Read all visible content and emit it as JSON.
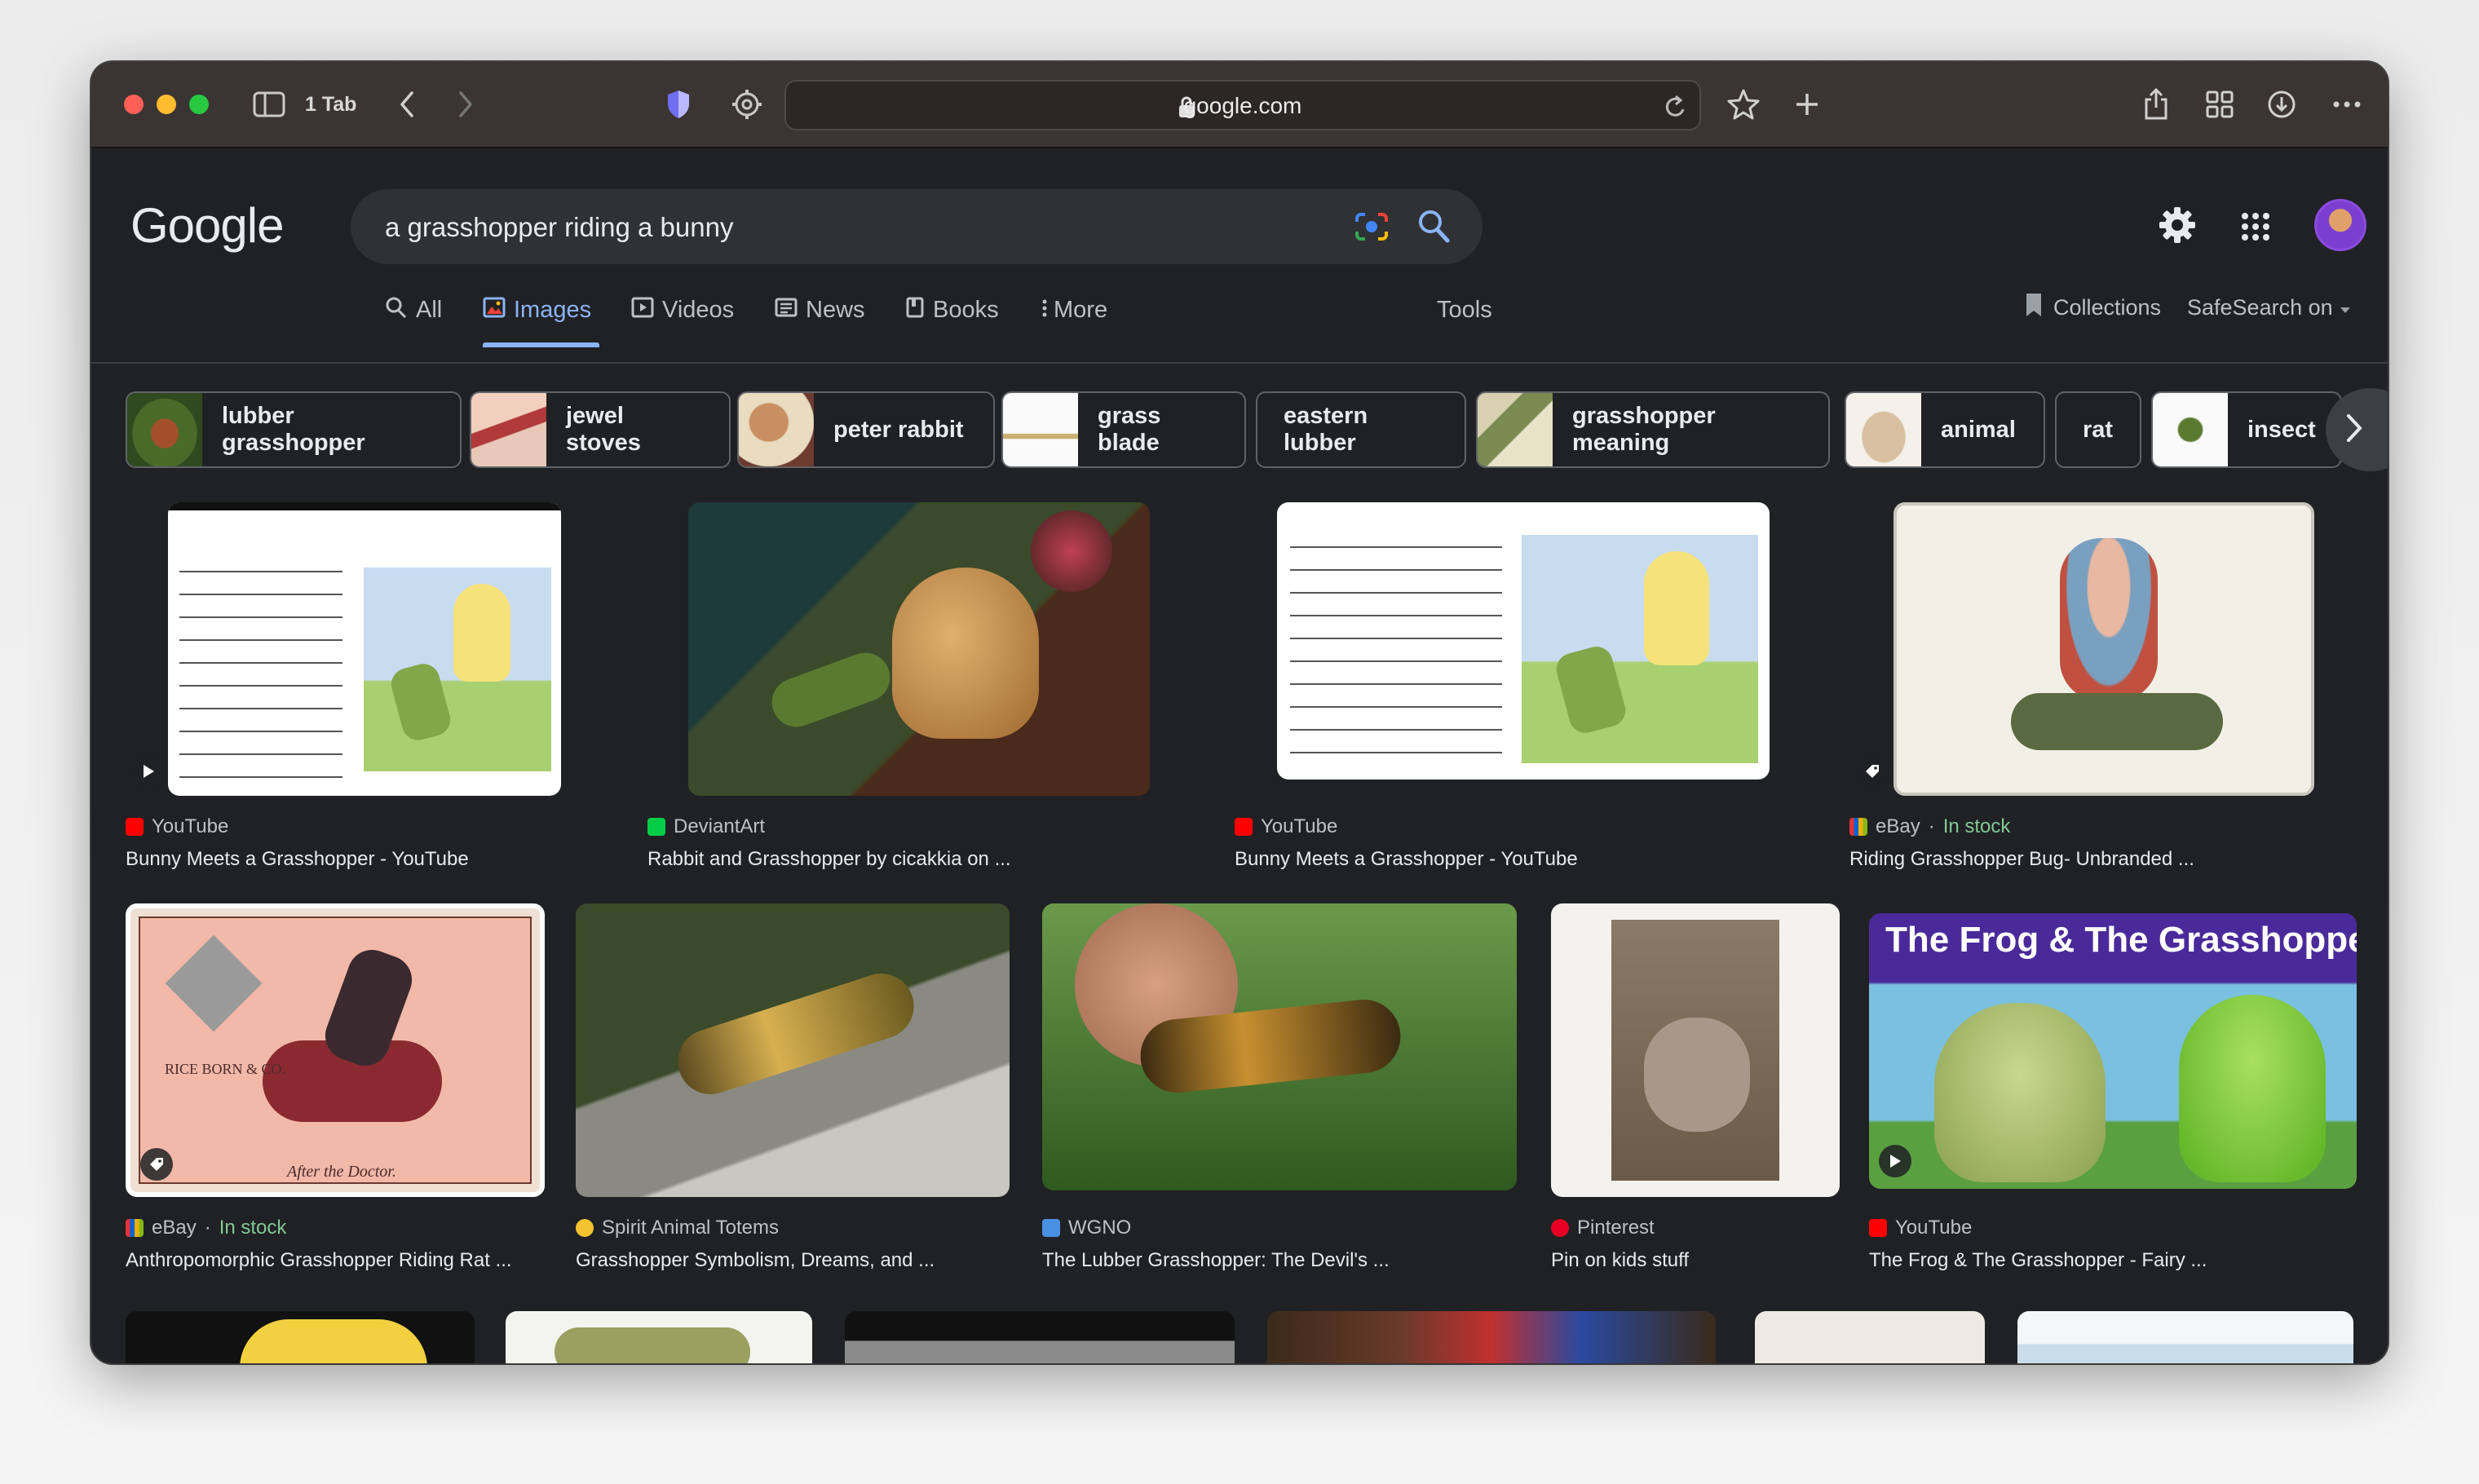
{
  "browser": {
    "tab_count": "1 Tab",
    "url": "google.com"
  },
  "google": {
    "logo": "Google",
    "query": "a grasshopper riding a bunny"
  },
  "tabs": [
    {
      "label": "All"
    },
    {
      "label": "Images",
      "active": true
    },
    {
      "label": "Videos"
    },
    {
      "label": "News"
    },
    {
      "label": "Books"
    },
    {
      "label": "More"
    },
    {
      "label": "Tools"
    }
  ],
  "collections_label": "Collections",
  "safesearch_label": "SafeSearch on",
  "chips": [
    {
      "label": "lubber grasshopper"
    },
    {
      "label": "jewel stoves"
    },
    {
      "label": "peter rabbit"
    },
    {
      "label": "grass blade"
    },
    {
      "label": "eastern lubber"
    },
    {
      "label": "grasshopper meaning"
    },
    {
      "label": "animal"
    },
    {
      "label": "rat"
    },
    {
      "label": "insect"
    }
  ],
  "results": [
    {
      "source": "YouTube",
      "title": "Bunny Meets a Grasshopper - YouTube"
    },
    {
      "source": "DeviantArt",
      "title": "Rabbit and Grasshopper by cicakkia on ..."
    },
    {
      "source": "YouTube",
      "title": "Bunny Meets a Grasshopper - YouTube"
    },
    {
      "source": "eBay",
      "stock": "In stock",
      "title": "Riding Grasshopper Bug- Unbranded ..."
    },
    {
      "source": "eBay",
      "stock": "In stock",
      "title": "Anthropomorphic Grasshopper Riding Rat ..."
    },
    {
      "source": "Spirit Animal Totems",
      "title": "Grasshopper Symbolism, Dreams, and ..."
    },
    {
      "source": "WGNO",
      "title": "The Lubber Grasshopper: The Devil's ..."
    },
    {
      "source": "Pinterest",
      "title": "Pin on kids stuff"
    },
    {
      "source": "YouTube",
      "title": "The Frog & The Grasshopper - Fairy ..."
    }
  ],
  "image_texts": {
    "frog_banner": "The Frog & The Grasshopper",
    "card_maker": "RICE BORN & CO.",
    "card_caption": "After the Doctor."
  },
  "colors": {
    "background": "#202124",
    "accent": "#8ab4f8",
    "text": "#e8eaed",
    "in_stock": "#81c995"
  }
}
